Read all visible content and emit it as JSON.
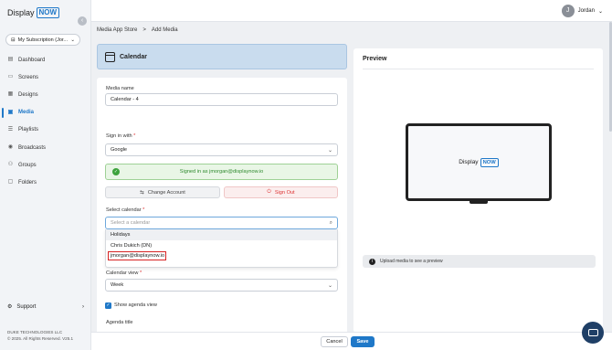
{
  "brand": {
    "display": "Display",
    "now": "NOW"
  },
  "subscription": {
    "label": "My Subscription (Jor..."
  },
  "sidebar": {
    "items": [
      {
        "label": "Dashboard",
        "icon": "dashboard-icon"
      },
      {
        "label": "Screens",
        "icon": "screen-icon"
      },
      {
        "label": "Designs",
        "icon": "design-icon"
      },
      {
        "label": "Media",
        "icon": "media-icon",
        "active": true
      },
      {
        "label": "Playlists",
        "icon": "playlist-icon"
      },
      {
        "label": "Broadcasts",
        "icon": "broadcast-icon"
      },
      {
        "label": "Groups",
        "icon": "groups-icon"
      },
      {
        "label": "Folders",
        "icon": "folder-icon"
      }
    ],
    "support_label": "Support",
    "company_line1": "DUKE TECHNOLOGIES LLC",
    "company_line2": "© 2025. All Rights Reserved. V25.1"
  },
  "user": {
    "initial": "J",
    "name": "Jordan"
  },
  "breadcrumb": {
    "first": "Media App Store",
    "separator": ">",
    "current": "Add Media"
  },
  "header": {
    "title": "Calendar"
  },
  "form": {
    "media_name_label": "Media name",
    "media_name_value": "Calendar - 4",
    "sign_in_label": "Sign in with",
    "sign_in_value": "Google",
    "signed_in_text": "Signed in as jmorgan@displaynow.io",
    "change_account_label": "Change Account",
    "sign_out_label": "Sign Out",
    "select_calendar_label": "Select calendar",
    "select_calendar_placeholder": "Select a calendar",
    "calendar_options": [
      "Holidays",
      "Chris Dukich (DN)",
      "jmorgan@displaynow.io"
    ],
    "calendar_view_label": "Calendar view",
    "calendar_view_value": "Week",
    "show_agenda_label": "Show agenda view",
    "show_agenda_checked": true,
    "agenda_title_label": "Agenda title",
    "required_mark": "*"
  },
  "preview": {
    "title": "Preview",
    "upload_note": "Upload media to see a preview"
  },
  "footer": {
    "cancel_label": "Cancel",
    "save_label": "Save"
  },
  "colors": {
    "accent": "#1f78c8",
    "success": "#3da33d",
    "danger": "#d33333",
    "header_bg": "#c9dcee"
  }
}
